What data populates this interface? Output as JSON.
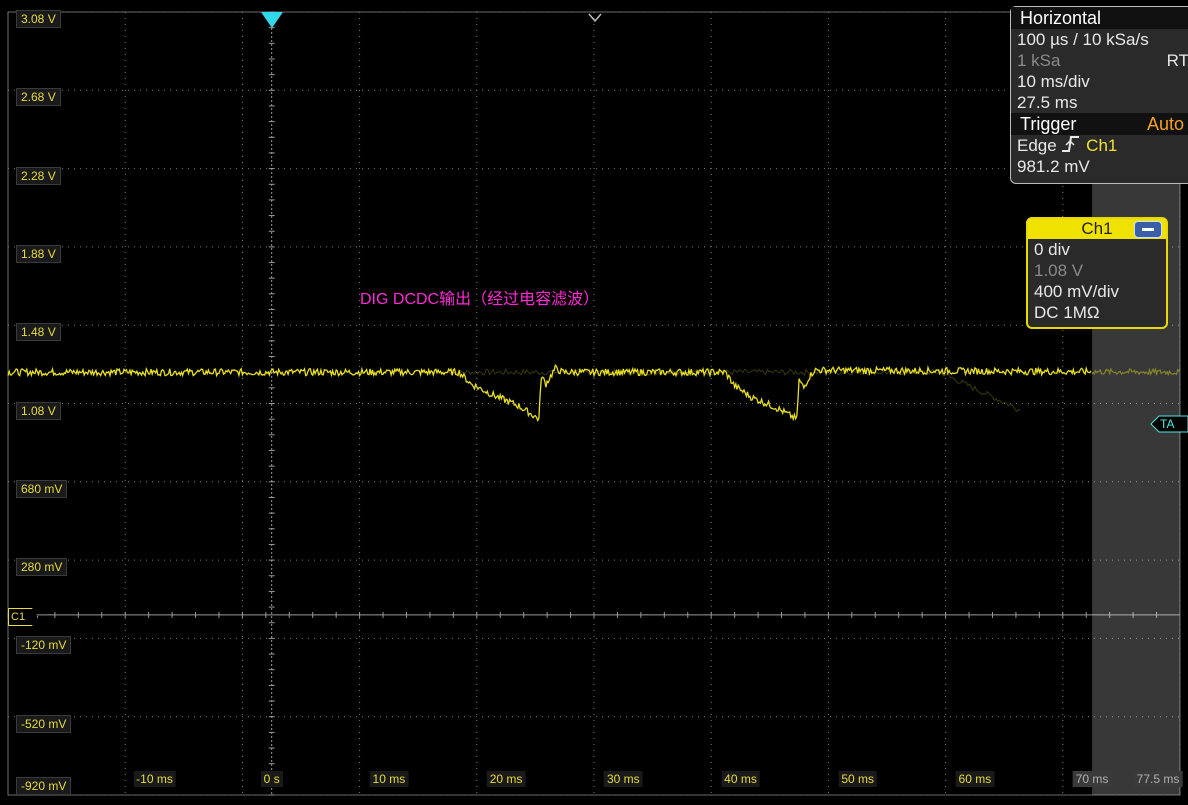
{
  "screen": {
    "annotation": "DIG DCDC输出（经过电容滤波）",
    "y_axis_labels": [
      "3.08 V",
      "2.68 V",
      "2.28 V",
      "1.88 V",
      "1.48 V",
      "1.08 V",
      "680 mV",
      "280 mV",
      "-120 mV",
      "-520 mV",
      "-920 mV"
    ],
    "x_axis_labels": [
      "-10 ms",
      "0 s",
      "10 ms",
      "20 ms",
      "30 ms",
      "40 ms",
      "50 ms",
      "60 ms"
    ],
    "x_axis_labels_dim": [
      "70 ms",
      "77.5 ms"
    ],
    "ch1_marker": "C1",
    "trigger_tag": "TA"
  },
  "horizontal": {
    "title": "Horizontal",
    "rate": "100 µs / 10 kSa/s",
    "samples": "1 kSa",
    "mode": "RT",
    "timebase": "10 ms/div",
    "position": "27.5 ms"
  },
  "trigger": {
    "title": "Trigger",
    "mode": "Auto",
    "type": "Edge",
    "source": "Ch1",
    "level": "981.2 mV"
  },
  "channel": {
    "title": "Ch1",
    "offset_div": "0 div",
    "offset_v": "1.08 V",
    "scale": "400 mV/div",
    "coupling": "DC 1MΩ"
  },
  "colors": {
    "trace": "#e8e020",
    "annotation": "#ff2ad4",
    "trigger_marker": "#30d8e8",
    "grid": "#7a7a7a"
  },
  "chart_data": {
    "type": "line",
    "xlabel": "",
    "ylabel": "",
    "xlim": [
      -22.5,
      77.5
    ],
    "ylim": [
      -0.92,
      3.08
    ],
    "series": [
      {
        "name": "Ch1",
        "x": [
          -22.5,
          16,
          17,
          19,
          21,
          22.3,
          22.8,
          23,
          23.4,
          23.8,
          24.2,
          24.8,
          38.7,
          39.5,
          41,
          43,
          44.5,
          44.8,
          45,
          45.4,
          45.8,
          46.3,
          77.5
        ],
        "y": [
          1.24,
          1.24,
          1.18,
          1.12,
          1.07,
          1.02,
          1.0,
          1.22,
          1.18,
          1.22,
          1.26,
          1.24,
          1.24,
          1.17,
          1.11,
          1.06,
          1.01,
          1.0,
          1.2,
          1.16,
          1.21,
          1.25,
          1.24
        ]
      }
    ]
  }
}
